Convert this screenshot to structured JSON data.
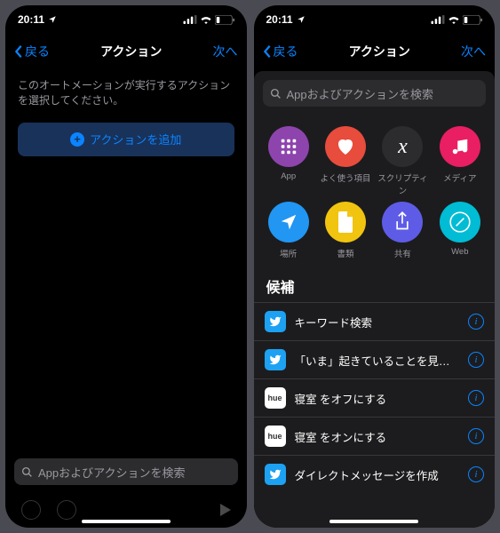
{
  "status": {
    "time": "20:11",
    "signal": "●●●●",
    "wifi": "wifi",
    "battery": "low"
  },
  "nav": {
    "back": "戻る",
    "title": "アクション",
    "next": "次へ"
  },
  "left": {
    "instruction": "このオートメーションが実行するアクションを選択してください。",
    "add_action": "アクションを追加",
    "search_placeholder": "Appおよびアクションを検索"
  },
  "right": {
    "search_placeholder": "Appおよびアクションを検索",
    "categories": [
      {
        "label": "App",
        "color": "c-purple",
        "icon": "grid"
      },
      {
        "label": "よく使う項目",
        "color": "c-red",
        "icon": "heart"
      },
      {
        "label": "スクリプティン",
        "color": "c-dark",
        "icon": "x"
      },
      {
        "label": "メディア",
        "color": "c-pink",
        "icon": "music"
      },
      {
        "label": "場所",
        "color": "c-blue",
        "icon": "nav"
      },
      {
        "label": "書類",
        "color": "c-yellow",
        "icon": "doc"
      },
      {
        "label": "共有",
        "color": "c-indigo",
        "icon": "share"
      },
      {
        "label": "Web",
        "color": "c-cyan",
        "icon": "safari"
      }
    ],
    "section": "候補",
    "suggestions": [
      {
        "app": "tw",
        "label": "キーワード検索"
      },
      {
        "app": "tw",
        "label": "「いま」起きていることを見つけよう"
      },
      {
        "app": "hue",
        "label": "寝室 をオフにする"
      },
      {
        "app": "hue",
        "label": "寝室 をオンにする"
      },
      {
        "app": "tw",
        "label": "ダイレクトメッセージを作成"
      }
    ]
  }
}
